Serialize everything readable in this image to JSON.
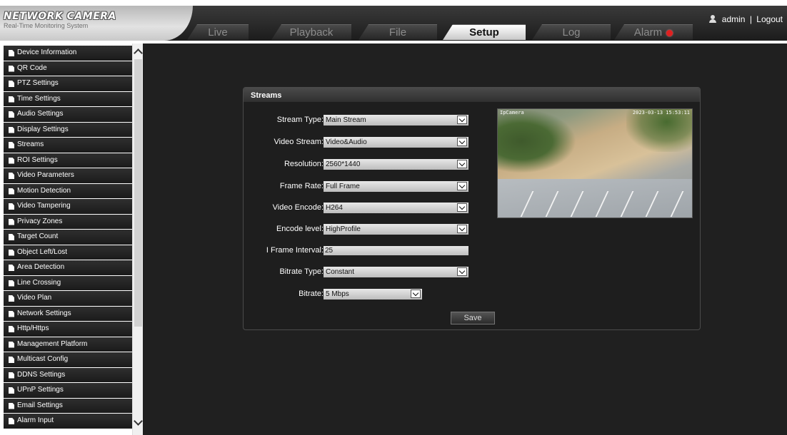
{
  "header": {
    "brand_title": "NETWORK CAMERA",
    "brand_subtitle": "Real-Time Monitoring System",
    "tabs": [
      {
        "label": "Live",
        "active": false
      },
      {
        "label": "Playback",
        "active": false
      },
      {
        "label": "File",
        "active": false
      },
      {
        "label": "Setup",
        "active": true
      },
      {
        "label": "Log",
        "active": false
      },
      {
        "label": "Alarm",
        "active": false
      }
    ],
    "user": "admin",
    "separator": "|",
    "logout": "Logout"
  },
  "sidebar": {
    "items": [
      "Device Information",
      "QR Code",
      "PTZ Settings",
      "Time Settings",
      "Audio Settings",
      "Display Settings",
      "Streams",
      "ROI Settings",
      "Video Parameters",
      "Motion Detection",
      "Video Tampering",
      "Privacy Zones",
      "Target Count",
      "Object Left/Lost",
      "Area Detection",
      "Line Crossing",
      "Video Plan",
      "Network Settings",
      "Http/Https",
      "Management Platform",
      "Multicast Config",
      "DDNS Settings",
      "UPnP Settings",
      "Email Settings",
      "Alarm Input"
    ]
  },
  "panel": {
    "title": "Streams",
    "fields": {
      "stream_type": {
        "label": "Stream Type:",
        "value": "Main Stream"
      },
      "video_stream": {
        "label": "Video Stream:",
        "value": "Video&Audio"
      },
      "resolution": {
        "label": "Resolution:",
        "value": "2560*1440"
      },
      "frame_rate": {
        "label": "Frame Rate:",
        "value": "Full Frame"
      },
      "video_encode": {
        "label": "Video Encode:",
        "value": "H264"
      },
      "encode_level": {
        "label": "Encode level:",
        "value": "HighProfile"
      },
      "i_frame_interval": {
        "label": "I Frame Interval:",
        "value": "25"
      },
      "bitrate_type": {
        "label": "Bitrate Type:",
        "value": "Constant"
      },
      "bitrate": {
        "label": "Bitrate:",
        "value": "5 Mbps"
      }
    },
    "save_label": "Save",
    "preview": {
      "camera_name": "IpCamera",
      "timestamp": "2023-03-13 15:53:11"
    }
  },
  "colors": {
    "background": "#202020",
    "alarm_indicator": "#e02020"
  },
  "icons": {
    "menu_item": "document-icon",
    "user": "user-icon",
    "alarm": "alarm-light-icon",
    "select": "chevron-down-icon"
  }
}
